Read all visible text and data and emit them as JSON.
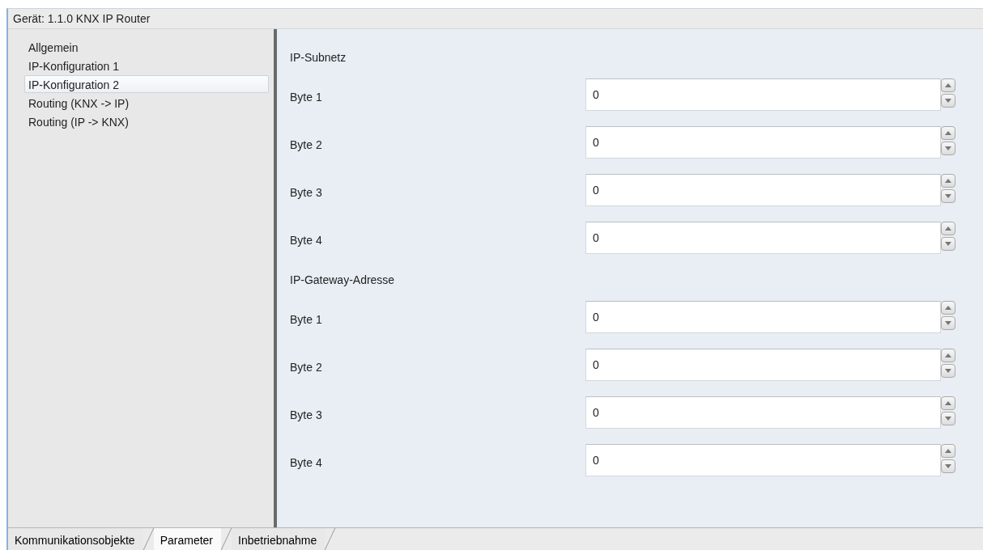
{
  "window": {
    "title": "Gerät: 1.1.0  KNX IP Router"
  },
  "sidebar": {
    "items": [
      {
        "label": "Allgemein",
        "selected": false
      },
      {
        "label": "IP-Konfiguration 1",
        "selected": false
      },
      {
        "label": "IP-Konfiguration 2",
        "selected": true
      },
      {
        "label": "Routing (KNX -> IP)",
        "selected": false
      },
      {
        "label": "Routing (IP -> KNX)",
        "selected": false
      }
    ]
  },
  "sections": [
    {
      "heading": "IP-Subnetz",
      "fields": [
        {
          "label": "Byte 1",
          "value": "0"
        },
        {
          "label": "Byte 2",
          "value": "0"
        },
        {
          "label": "Byte 3",
          "value": "0"
        },
        {
          "label": "Byte 4",
          "value": "0"
        }
      ]
    },
    {
      "heading": "IP-Gateway-Adresse",
      "fields": [
        {
          "label": "Byte 1",
          "value": "0"
        },
        {
          "label": "Byte 2",
          "value": "0"
        },
        {
          "label": "Byte 3",
          "value": "0"
        },
        {
          "label": "Byte 4",
          "value": "0"
        }
      ]
    }
  ],
  "tabs": [
    {
      "label": "Kommunikationsobjekte",
      "selected": false
    },
    {
      "label": "Parameter",
      "selected": true
    },
    {
      "label": "Inbetriebnahme",
      "selected": false
    }
  ]
}
